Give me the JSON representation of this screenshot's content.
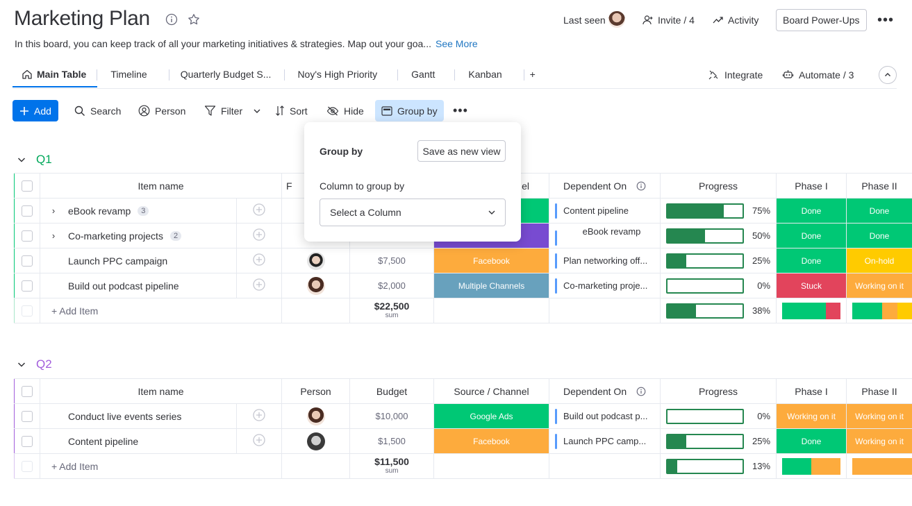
{
  "board": {
    "title": "Marketing Plan",
    "description": "In this board, you can keep track of all your marketing initiatives & strategies. Map out your goa...",
    "see_more": "See More"
  },
  "header": {
    "last_seen": "Last seen",
    "invite": "Invite / 4",
    "activity": "Activity",
    "power_ups": "Board Power-Ups"
  },
  "tabs": [
    {
      "label": "Main Table"
    },
    {
      "label": "Timeline"
    },
    {
      "label": "Quarterly Budget S..."
    },
    {
      "label": "Noy's High Priority"
    },
    {
      "label": "Gantt"
    },
    {
      "label": "Kanban"
    },
    {
      "label": "+"
    }
  ],
  "tab_actions": {
    "integrate": "Integrate",
    "automate": "Automate / 3"
  },
  "toolbar": {
    "add": "Add",
    "search": "Search",
    "person": "Person",
    "filter": "Filter",
    "sort": "Sort",
    "hide": "Hide",
    "group_by": "Group by"
  },
  "popup": {
    "title": "Group by",
    "save_view": "Save as new view",
    "column_label": "Column to group by",
    "select_placeholder": "Select a Column"
  },
  "columns": {
    "item_name": "Item name",
    "person": "Person",
    "budget": "Budget",
    "source": "Source / Channel",
    "dependent": "Dependent On",
    "progress": "Progress",
    "phase1": "Phase I",
    "phase2": "Phase II"
  },
  "colors": {
    "done": "#00c875",
    "working": "#fdab3d",
    "stuck": "#e2445c",
    "onhold": "#ffcb00",
    "purple": "#784bd1",
    "steel": "#68a1bd",
    "q1": "#00c875",
    "q2": "#a25ddc"
  },
  "groups": [
    {
      "name": "Q1",
      "column_header_partial": {
        "person": "F",
        "source": "el"
      },
      "rows": [
        {
          "name": "eBook revamp",
          "count": "3",
          "budget": "",
          "source": "",
          "dependent": "Content pipeline",
          "progress": "75%",
          "phase1": "Done",
          "phase2": "Done"
        },
        {
          "name": "Co-marketing projects",
          "count": "2",
          "budget": "",
          "source": "",
          "dependent": "eBook revamp",
          "progress": "50%",
          "phase1": "Done",
          "phase2": "Done"
        },
        {
          "name": "Launch PPC campaign",
          "budget": "$7,500",
          "source": "Facebook",
          "dependent": "Plan networking off...",
          "progress": "25%",
          "phase1": "Done",
          "phase2": "On-hold"
        },
        {
          "name": "Build out podcast pipeline",
          "budget": "$2,000",
          "source": "Multiple Channels",
          "dependent": "Co-marketing proje...",
          "progress": "0%",
          "phase1": "Stuck",
          "phase2": "Working on it"
        }
      ],
      "add_item": "+ Add Item",
      "sum_value": "$22,500",
      "sum_label": "sum",
      "sum_progress": "38%"
    },
    {
      "name": "Q2",
      "rows": [
        {
          "name": "Conduct live events series",
          "budget": "$10,000",
          "source": "Google Ads",
          "dependent": "Build out podcast p...",
          "progress": "0%",
          "phase1": "Working on it",
          "phase2": "Working on it"
        },
        {
          "name": "Content pipeline",
          "budget": "$1,500",
          "source": "Facebook",
          "dependent": "Launch PPC camp...",
          "progress": "25%",
          "phase1": "Done",
          "phase2": "Working on it"
        }
      ],
      "add_item": "+ Add Item",
      "sum_value": "$11,500",
      "sum_label": "sum",
      "sum_progress": "13%"
    }
  ]
}
